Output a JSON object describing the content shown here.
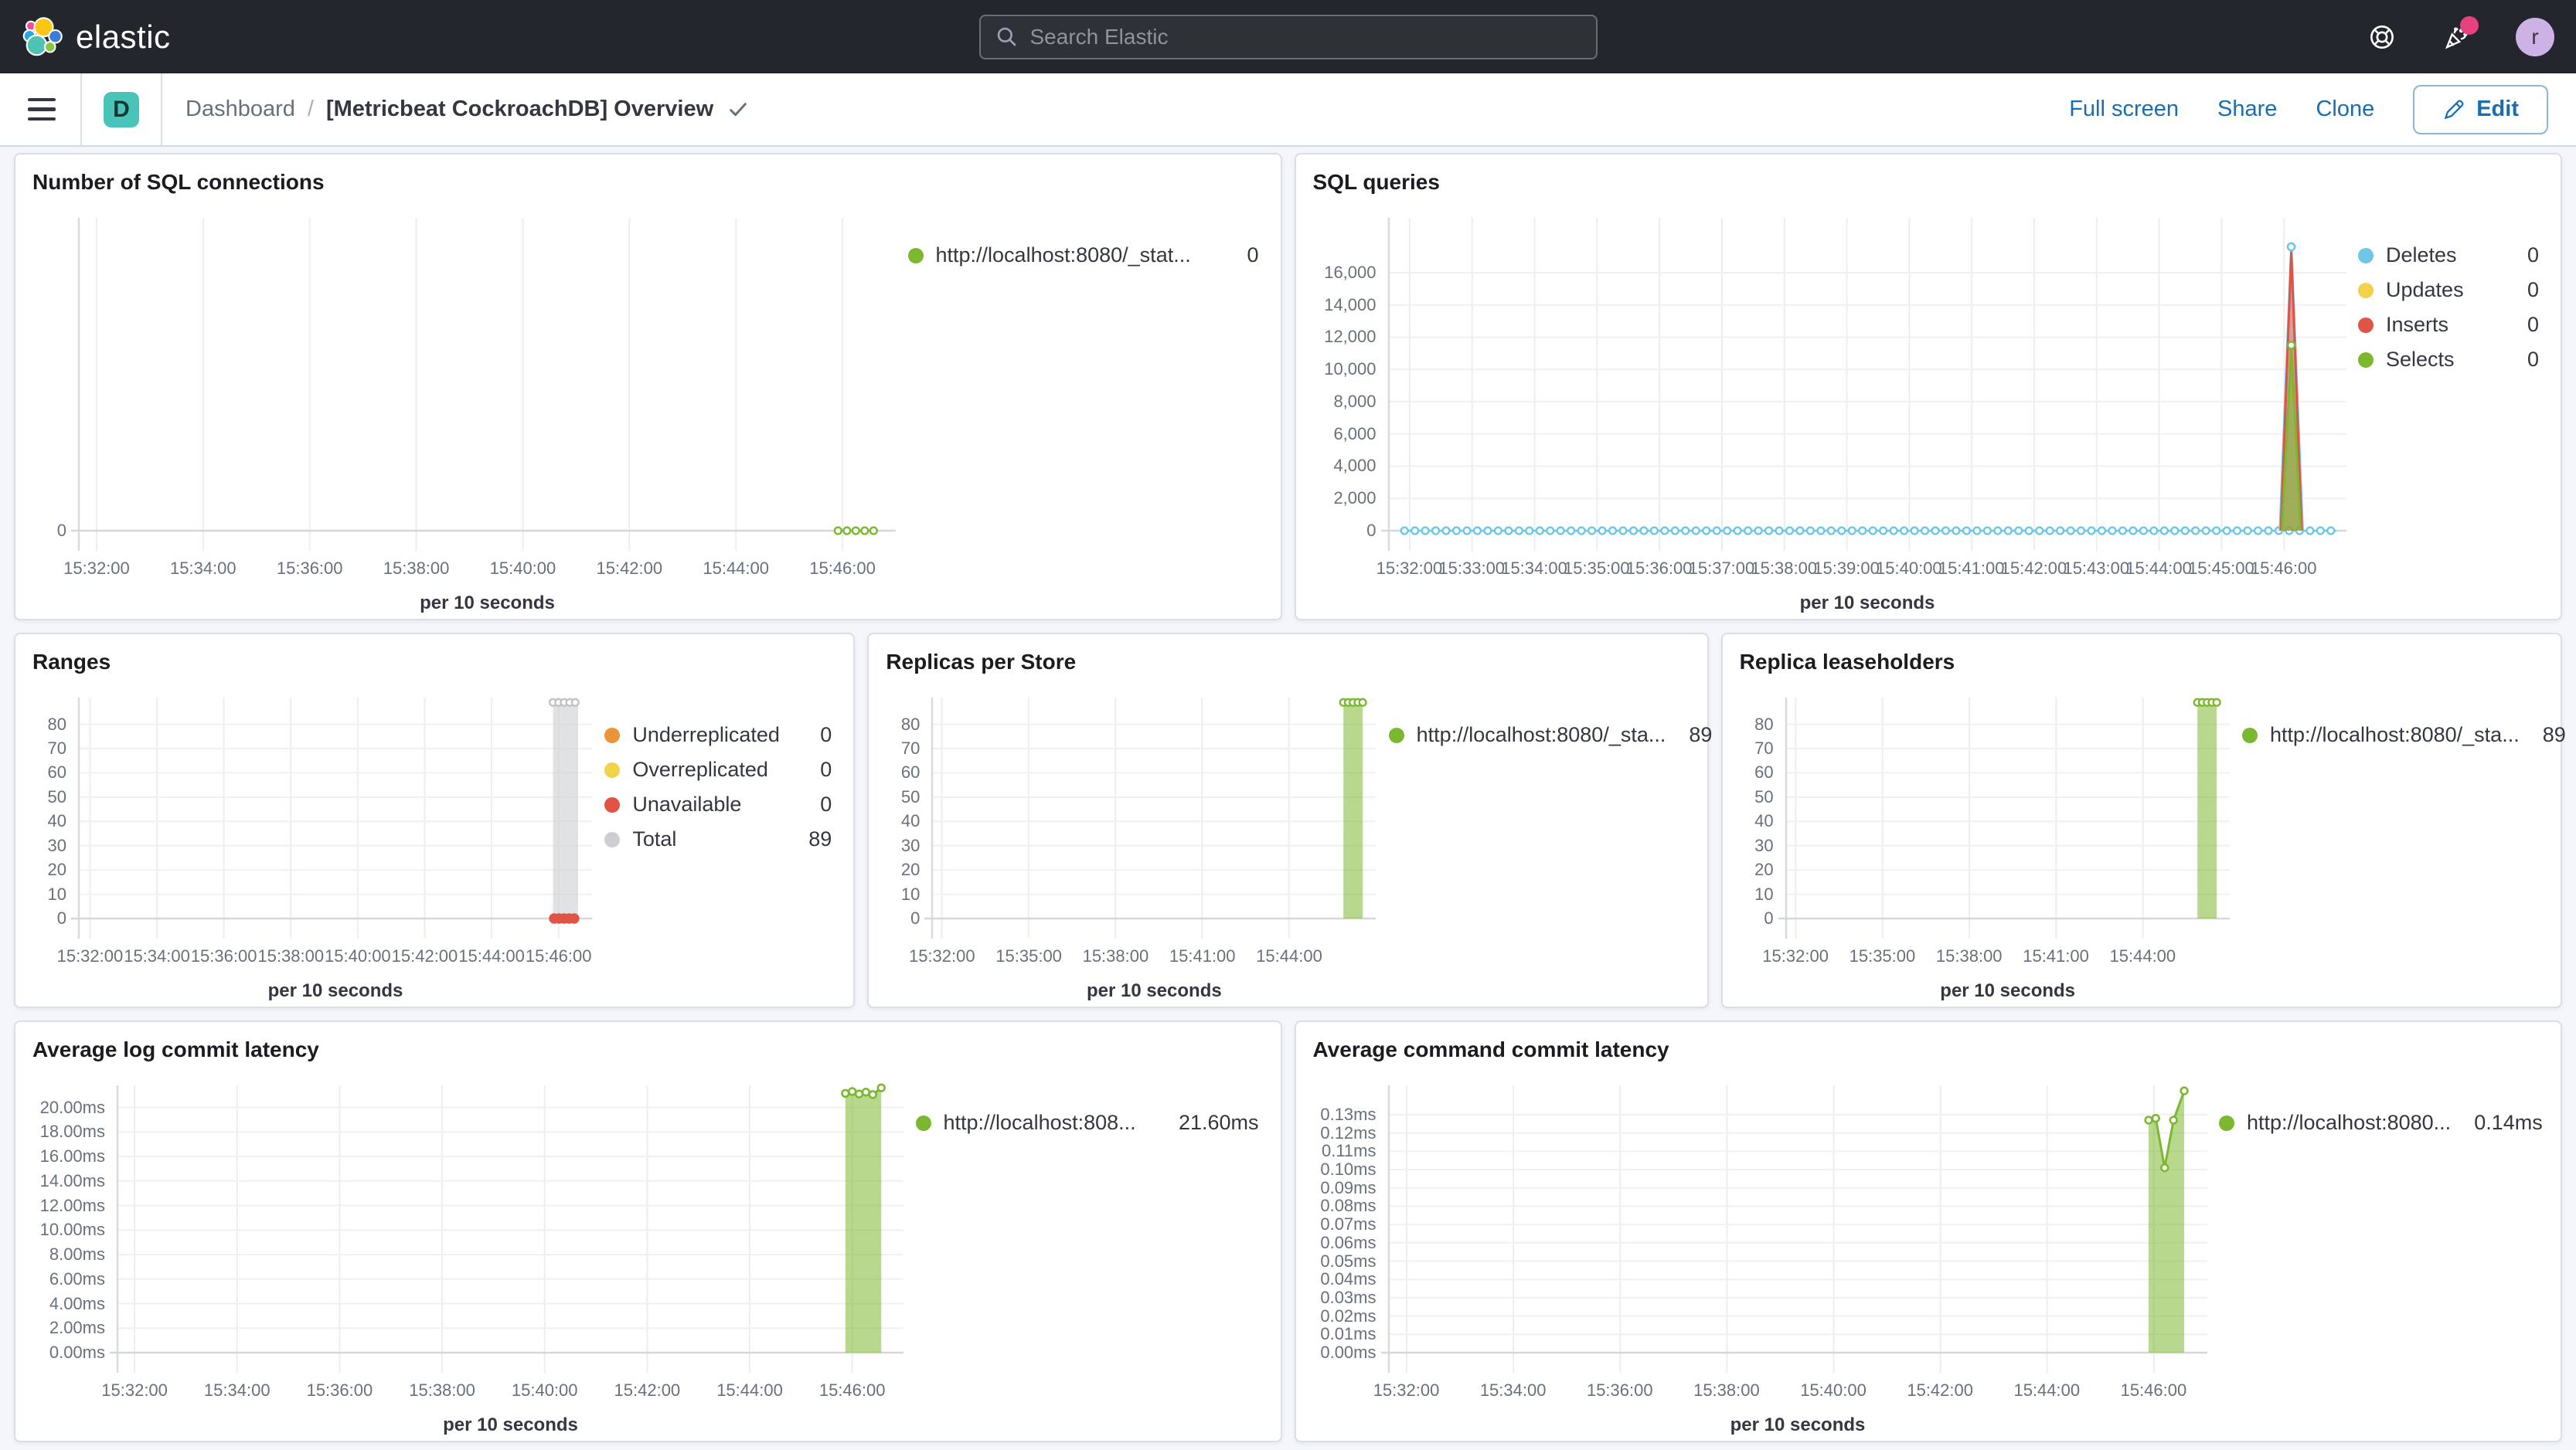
{
  "topbar": {
    "logo_text": "elastic",
    "search": {
      "placeholder": "Search Elastic"
    },
    "avatar_initial": "r",
    "colors": {
      "bar_bg": "#23262C",
      "news_badge": "#E7417E",
      "avatar_bg": "#CDB2E6"
    }
  },
  "navbar": {
    "app_badge": "D",
    "app_badge_color": "#48C5B8",
    "breadcrumb": {
      "root": "Dashboard",
      "separator": "/",
      "current": "[Metricbeat CockroachDB] Overview"
    },
    "actions": {
      "full_screen": "Full screen",
      "share": "Share",
      "clone": "Clone",
      "edit": "Edit"
    },
    "link_color": "#1A6DAE"
  },
  "charts": [
    {
      "title": "Number of SQL connections",
      "type": "line",
      "x_title": "per 10 seconds",
      "x_domain": [
        "15:31:40",
        "15:47:00"
      ],
      "x_ticks": [
        "15:32:00",
        "15:34:00",
        "15:36:00",
        "15:38:00",
        "15:40:00",
        "15:42:00",
        "15:44:00",
        "15:46:00"
      ],
      "ylim": [
        0,
        1
      ],
      "y_ticks": [
        [
          0,
          "0"
        ]
      ],
      "series": [
        {
          "name": "http://localhost:8080/_stat...",
          "type": "zero_dots",
          "color": "#7CB82F",
          "v": 0,
          "from": "15:45:55",
          "to": "15:46:35",
          "interval": 10
        }
      ],
      "legend": [
        {
          "label": "http://localhost:8080/_stat...",
          "value": "0",
          "color": "#7CB82F"
        }
      ]
    },
    {
      "title": "SQL queries",
      "type": "area",
      "x_title": "per 10 seconds",
      "x_domain": [
        "15:31:40",
        "15:47:00"
      ],
      "x_ticks": [
        "15:32:00",
        "15:33:00",
        "15:34:00",
        "15:35:00",
        "15:36:00",
        "15:37:00",
        "15:38:00",
        "15:39:00",
        "15:40:00",
        "15:41:00",
        "15:42:00",
        "15:43:00",
        "15:44:00",
        "15:45:00",
        "15:46:00"
      ],
      "ylim": [
        0,
        19400
      ],
      "y_ticks": [
        [
          0,
          "0"
        ],
        [
          2000,
          "2,000"
        ],
        [
          4000,
          "4,000"
        ],
        [
          6000,
          "6,000"
        ],
        [
          8000,
          "8,000"
        ],
        [
          10000,
          "10,000"
        ],
        [
          12000,
          "12,000"
        ],
        [
          14000,
          "14,000"
        ],
        [
          16000,
          "16,000"
        ]
      ],
      "series": [
        {
          "name": "Deletes baseline",
          "type": "zero_dots",
          "color": "#6EC7E7",
          "v": 0,
          "from": "15:31:55",
          "to": "15:46:50",
          "interval": 10
        },
        {
          "name": "Deletes spike",
          "type": "area",
          "color": "#6EC7E7",
          "fill": "rgba(110,199,231,0.35)",
          "points": [
            [
              "15:45:56",
              0
            ],
            [
              "15:46:07",
              17600
            ],
            [
              "15:46:18",
              0
            ]
          ],
          "peak_marker": true
        },
        {
          "name": "Inserts spike",
          "type": "area",
          "color": "#E05446",
          "fill": "rgba(224,84,70,0.5)",
          "points": [
            [
              "15:45:57",
              0
            ],
            [
              "15:46:07",
              17300
            ],
            [
              "15:46:17",
              0
            ]
          ]
        },
        {
          "name": "Selects spike",
          "type": "area",
          "color": "#7CB82F",
          "fill": "rgba(124,184,47,0.6)",
          "points": [
            [
              "15:45:58",
              0
            ],
            [
              "15:46:07",
              11500
            ],
            [
              "15:46:16",
              0
            ]
          ],
          "peak_marker": true
        }
      ],
      "legend": [
        {
          "label": "Deletes",
          "value": "0",
          "color": "#6EC7E7"
        },
        {
          "label": "Updates",
          "value": "0",
          "color": "#F1D24B"
        },
        {
          "label": "Inserts",
          "value": "0",
          "color": "#E05446"
        },
        {
          "label": "Selects",
          "value": "0",
          "color": "#7CB82F"
        }
      ]
    },
    {
      "title": "Ranges",
      "type": "bar",
      "x_title": "per 10 seconds",
      "x_domain": [
        "15:31:40",
        "15:47:00"
      ],
      "x_ticks": [
        "15:32:00",
        "15:34:00",
        "15:36:00",
        "15:38:00",
        "15:40:00",
        "15:42:00",
        "15:44:00",
        "15:46:00"
      ],
      "ylim": [
        0,
        91
      ],
      "y_ticks": [
        [
          0,
          "0"
        ],
        [
          10,
          "10"
        ],
        [
          20,
          "20"
        ],
        [
          30,
          "30"
        ],
        [
          40,
          "40"
        ],
        [
          50,
          "50"
        ],
        [
          60,
          "60"
        ],
        [
          70,
          "70"
        ],
        [
          80,
          "80"
        ]
      ],
      "series": [
        {
          "name": "Total",
          "type": "bar",
          "fill": "rgba(205,207,210,0.6)",
          "marker_color": "#C0C3C7",
          "t0": "15:45:50",
          "t1": "15:46:35",
          "v": 89,
          "top_markers": true,
          "marker_interval": 10
        },
        {
          "name": "Unavailable",
          "type": "zero_dots",
          "color": "#E05446",
          "solid": true,
          "v": 0,
          "from": "15:45:52",
          "to": "15:46:33",
          "interval": 9
        }
      ],
      "legend": [
        {
          "label": "Underreplicated",
          "value": "0",
          "color": "#EB9438"
        },
        {
          "label": "Overreplicated",
          "value": "0",
          "color": "#F1D24B"
        },
        {
          "label": "Unavailable",
          "value": "0",
          "color": "#E05446"
        },
        {
          "label": "Total",
          "value": "89",
          "color": "#CDCFD2"
        }
      ]
    },
    {
      "title": "Replicas per Store",
      "type": "bar",
      "x_title": "per 10 seconds",
      "x_domain": [
        "15:31:40",
        "15:47:00"
      ],
      "x_ticks": [
        "15:32:00",
        "15:35:00",
        "15:38:00",
        "15:41:00",
        "15:44:00"
      ],
      "ylim": [
        0,
        91
      ],
      "y_ticks": [
        [
          0,
          "0"
        ],
        [
          10,
          "10"
        ],
        [
          20,
          "20"
        ],
        [
          30,
          "30"
        ],
        [
          40,
          "40"
        ],
        [
          50,
          "50"
        ],
        [
          60,
          "60"
        ],
        [
          70,
          "70"
        ],
        [
          80,
          "80"
        ]
      ],
      "series": [
        {
          "name": "http://localhost:8080/_sta...",
          "type": "bar",
          "fill": "rgba(124,184,47,0.55)",
          "marker_color": "#7CB82F",
          "t0": "15:45:53",
          "t1": "15:46:33",
          "v": 89,
          "top_markers": true,
          "marker_interval": 10
        }
      ],
      "legend": [
        {
          "label": "http://localhost:8080/_sta...",
          "value": "89",
          "color": "#7CB82F"
        }
      ]
    },
    {
      "title": "Replica leaseholders",
      "type": "bar",
      "x_title": "per 10 seconds",
      "x_domain": [
        "15:31:40",
        "15:47:00"
      ],
      "x_ticks": [
        "15:32:00",
        "15:35:00",
        "15:38:00",
        "15:41:00",
        "15:44:00"
      ],
      "ylim": [
        0,
        91
      ],
      "y_ticks": [
        [
          0,
          "0"
        ],
        [
          10,
          "10"
        ],
        [
          20,
          "20"
        ],
        [
          30,
          "30"
        ],
        [
          40,
          "40"
        ],
        [
          50,
          "50"
        ],
        [
          60,
          "60"
        ],
        [
          70,
          "70"
        ],
        [
          80,
          "80"
        ]
      ],
      "series": [
        {
          "name": "http://localhost:8080/_sta...",
          "type": "bar",
          "fill": "rgba(124,184,47,0.55)",
          "marker_color": "#7CB82F",
          "t0": "15:45:53",
          "t1": "15:46:33",
          "v": 89,
          "top_markers": true,
          "marker_interval": 10
        }
      ],
      "legend": [
        {
          "label": "http://localhost:8080/_sta...",
          "value": "89",
          "color": "#7CB82F"
        }
      ]
    },
    {
      "title": "Average log commit latency",
      "type": "area",
      "x_title": "per 10 seconds",
      "x_domain": [
        "15:31:40",
        "15:47:00"
      ],
      "x_ticks": [
        "15:32:00",
        "15:34:00",
        "15:36:00",
        "15:38:00",
        "15:40:00",
        "15:42:00",
        "15:44:00",
        "15:46:00"
      ],
      "ylim": [
        0,
        21.8
      ],
      "y_ticks": [
        [
          0,
          "0.00ms"
        ],
        [
          2,
          "2.00ms"
        ],
        [
          4,
          "4.00ms"
        ],
        [
          6,
          "6.00ms"
        ],
        [
          8,
          "8.00ms"
        ],
        [
          10,
          "10.00ms"
        ],
        [
          12,
          "12.00ms"
        ],
        [
          14,
          "14.00ms"
        ],
        [
          16,
          "16.00ms"
        ],
        [
          18,
          "18.00ms"
        ],
        [
          20,
          "20.00ms"
        ]
      ],
      "series": [
        {
          "name": "http://localhost:808...",
          "type": "area",
          "color": "#7CB82F",
          "fill": "rgba(124,184,47,0.55)",
          "markers": "all",
          "points": [
            [
              "15:45:52",
              21.15
            ],
            [
              "15:46:00",
              21.3
            ],
            [
              "15:46:08",
              21.1
            ],
            [
              "15:46:16",
              21.25
            ],
            [
              "15:46:24",
              21.05
            ],
            [
              "15:46:34",
              21.6
            ]
          ]
        }
      ],
      "legend": [
        {
          "label": "http://localhost:808...",
          "value": "21.60ms",
          "color": "#7CB82F"
        }
      ]
    },
    {
      "title": "Average command commit latency",
      "type": "area",
      "x_title": "per 10 seconds",
      "x_domain": [
        "15:31:40",
        "15:47:00"
      ],
      "x_ticks": [
        "15:32:00",
        "15:34:00",
        "15:36:00",
        "15:38:00",
        "15:40:00",
        "15:42:00",
        "15:44:00",
        "15:46:00"
      ],
      "ylim": [
        0,
        0.146
      ],
      "y_ticks": [
        [
          0,
          "0.00ms"
        ],
        [
          0.01,
          "0.01ms"
        ],
        [
          0.02,
          "0.02ms"
        ],
        [
          0.03,
          "0.03ms"
        ],
        [
          0.04,
          "0.04ms"
        ],
        [
          0.05,
          "0.05ms"
        ],
        [
          0.06,
          "0.06ms"
        ],
        [
          0.07,
          "0.07ms"
        ],
        [
          0.08,
          "0.08ms"
        ],
        [
          0.09,
          "0.09ms"
        ],
        [
          0.1,
          "0.10ms"
        ],
        [
          0.11,
          "0.11ms"
        ],
        [
          0.12,
          "0.12ms"
        ],
        [
          0.13,
          "0.13ms"
        ]
      ],
      "series": [
        {
          "name": "http://localhost:8080...",
          "type": "area",
          "color": "#7CB82F",
          "fill": "rgba(124,184,47,0.55)",
          "markers": "all",
          "points": [
            [
              "15:45:54",
              0.127
            ],
            [
              "15:46:02",
              0.128
            ],
            [
              "15:46:12",
              0.101
            ],
            [
              "15:46:22",
              0.127
            ],
            [
              "15:46:34",
              0.143
            ]
          ]
        }
      ],
      "legend": [
        {
          "label": "http://localhost:8080...",
          "value": "0.14ms",
          "color": "#7CB82F"
        }
      ]
    }
  ]
}
